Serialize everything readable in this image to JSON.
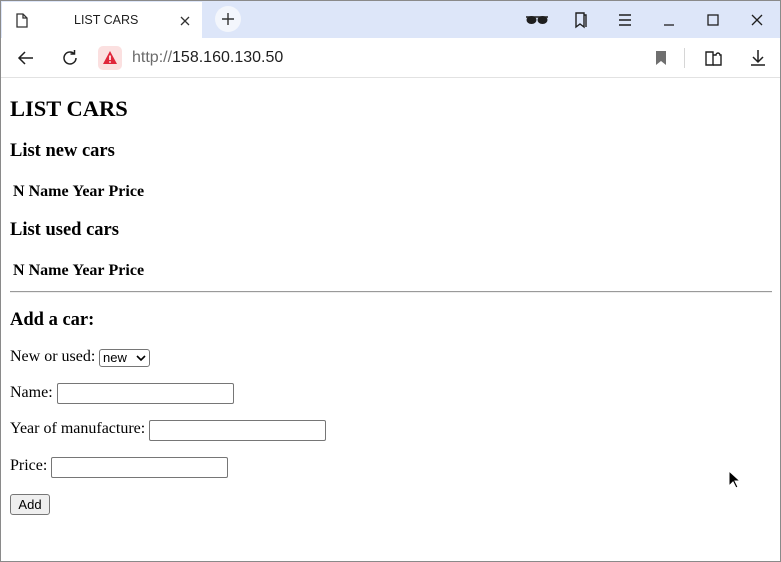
{
  "browser": {
    "tab_title": "LIST CARS",
    "url_scheme": "http://",
    "url_host": "158.160.130.50"
  },
  "page": {
    "title": "LIST CARS",
    "new_cars_heading": "List new cars",
    "used_cars_heading": "List used cars",
    "table_headers": [
      "N",
      "Name",
      "Year",
      "Price"
    ],
    "form": {
      "heading": "Add a car:",
      "type_label": "New or used:",
      "type_selected": "new",
      "name_label": "Name:",
      "name_value": "",
      "year_label": "Year of manufacture:",
      "year_value": "",
      "price_label": "Price:",
      "price_value": "",
      "submit_label": "Add"
    }
  },
  "icons": {
    "tab": [
      "document-icon",
      "close-icon",
      "plus-icon"
    ],
    "toolbar": [
      "glasses-icon",
      "collections-icon",
      "menu-icon",
      "minimize-icon",
      "maximize-icon",
      "window-close-icon"
    ],
    "nav": [
      "back-icon",
      "reload-icon",
      "warning-icon",
      "bookmark-icon",
      "extensions-icon",
      "download-icon"
    ]
  },
  "colors": {
    "tabstrip": "#dde6f9",
    "warning": "#e0263b",
    "warning_bg": "#fbe0e0"
  }
}
